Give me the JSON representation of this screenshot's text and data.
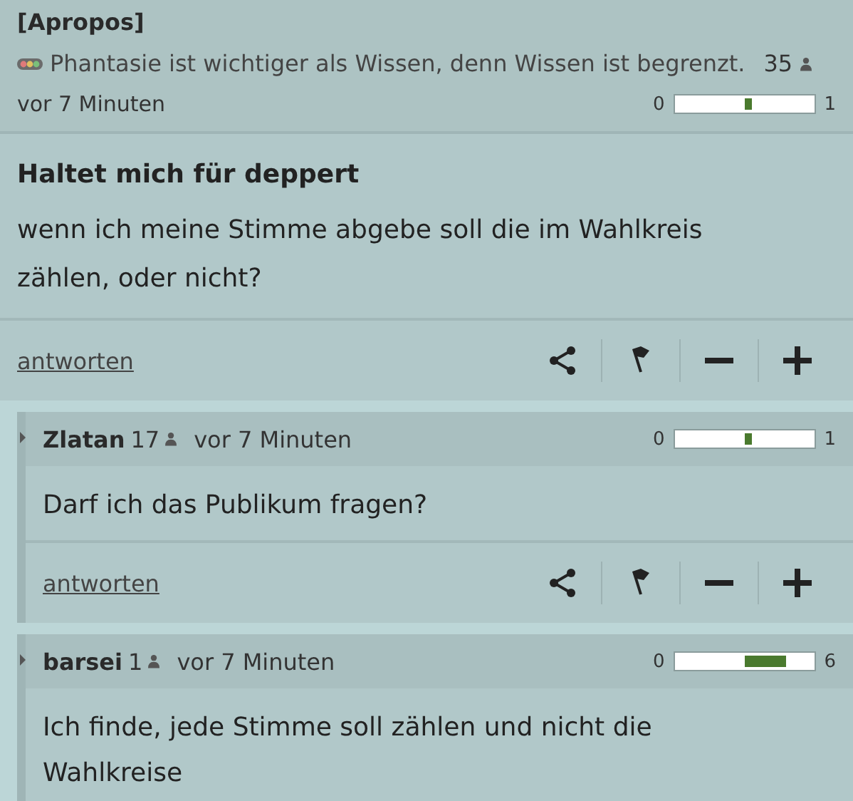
{
  "header": {
    "title": "[Apropos]",
    "motto": "Phantasie ist wichtiger als Wissen, denn Wissen ist begrenzt.",
    "count": "35",
    "time": "vor 7 Minuten",
    "rating": {
      "min": "0",
      "max": "1"
    }
  },
  "post": {
    "title": "Haltet mich für deppert",
    "body": "wenn ich meine Stimme abgebe soll die im Wahlkreis zählen, oder nicht?",
    "reply_link": "antworten"
  },
  "replies": [
    {
      "author": "Zlatan",
      "count": "17",
      "time": "vor 7 Minuten",
      "rating": {
        "min": "0",
        "max": "1"
      },
      "body": "Darf ich das Publikum fragen?",
      "reply_link": "antworten"
    },
    {
      "author": "barsei",
      "count": "1",
      "time": "vor 7 Minuten",
      "rating": {
        "min": "0",
        "max": "6"
      },
      "body": "Ich finde, jede Stimme soll zählen und nicht die Wahlkreise"
    }
  ]
}
